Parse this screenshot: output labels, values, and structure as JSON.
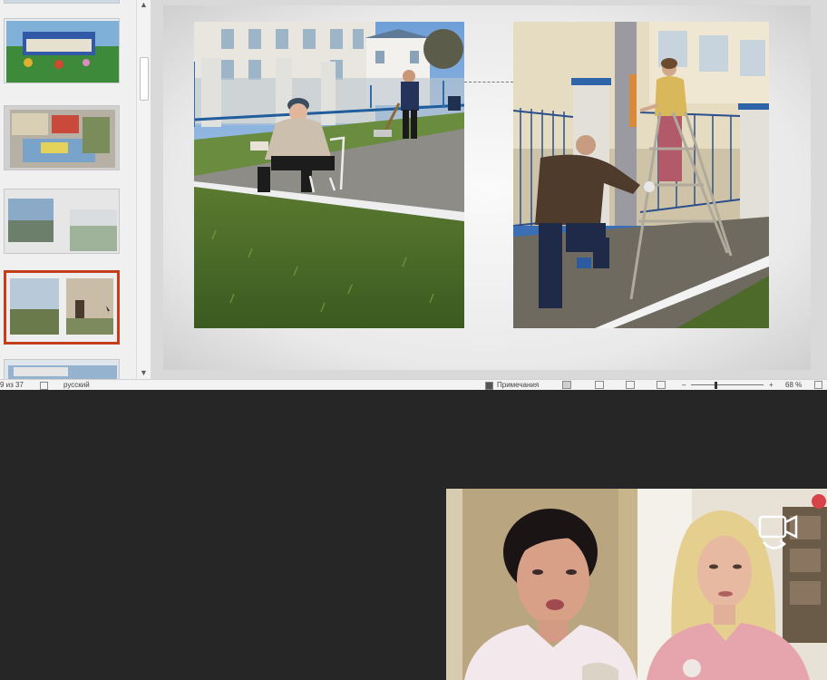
{
  "ppt": {
    "status": {
      "slide_counter": "9 из 37",
      "language": "русский",
      "notes_label": "Примечания",
      "zoom": "68 %"
    },
    "thumbnails": [
      {
        "name": "slide-thumb-playground"
      },
      {
        "name": "slide-thumb-classroom"
      },
      {
        "name": "slide-thumb-two-photos"
      },
      {
        "name": "slide-thumb-current",
        "selected": true
      },
      {
        "name": "slide-thumb-building"
      }
    ]
  },
  "colors": {
    "selection_border": "#c43e1c",
    "background_dark": "#262626"
  },
  "icons": {
    "camera_switch": "camera-switch-icon"
  }
}
